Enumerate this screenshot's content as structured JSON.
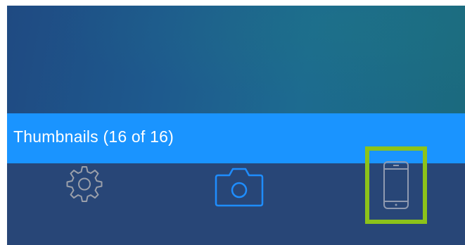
{
  "header": {
    "title": "Thumbnails (16 of 16)"
  },
  "toolbar": {
    "items": [
      {
        "icon": "gear-icon",
        "state": "normal"
      },
      {
        "icon": "camera-icon",
        "state": "active"
      },
      {
        "icon": "phone-icon",
        "state": "highlighted"
      }
    ]
  },
  "colors": {
    "title_bar": "#1a94ff",
    "toolbar_bg": "#284677",
    "gear": "#9a9faa",
    "camera": "#1e8dff",
    "phone": "#8f9ab0",
    "highlight": "#8cc31a"
  }
}
